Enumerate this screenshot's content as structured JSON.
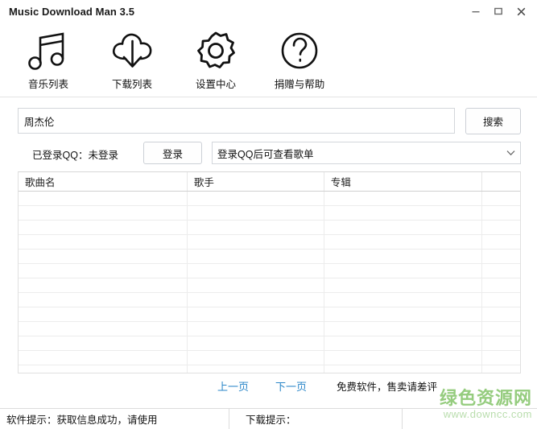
{
  "window": {
    "title": "Music Download Man 3.5",
    "controls": [
      {
        "name": "minimize",
        "label": "–"
      },
      {
        "name": "maximize",
        "label": "□"
      },
      {
        "name": "close",
        "label": "✕"
      }
    ]
  },
  "toolbar": {
    "items": [
      {
        "icon": "music-note-icon",
        "label": "音乐列表"
      },
      {
        "icon": "cloud-download-icon",
        "label": "下载列表"
      },
      {
        "icon": "gear-icon",
        "label": "设置中心"
      },
      {
        "icon": "question-circle-icon",
        "label": "捐赠与帮助"
      }
    ]
  },
  "search": {
    "value": "周杰伦",
    "placeholder": "",
    "button_label": "搜索"
  },
  "login": {
    "status_text": "已登录QQ：未登录",
    "button_label": "登录",
    "playlist_selected": "登录QQ后可查看歌单",
    "playlist_chevron": "chevron-down-icon"
  },
  "table": {
    "columns": [
      {
        "key": "song",
        "label": "歌曲名",
        "width": "33.6%"
      },
      {
        "key": "artist",
        "label": "歌手",
        "width": "27.3%"
      },
      {
        "key": "album",
        "label": "专辑",
        "width": "31.5%"
      },
      {
        "key": "extra",
        "label": "",
        "width": "7.6%"
      }
    ],
    "rows": [
      {
        "song": "",
        "artist": "",
        "album": "",
        "extra": ""
      },
      {
        "song": "",
        "artist": "",
        "album": "",
        "extra": ""
      },
      {
        "song": "",
        "artist": "",
        "album": "",
        "extra": ""
      },
      {
        "song": "",
        "artist": "",
        "album": "",
        "extra": ""
      },
      {
        "song": "",
        "artist": "",
        "album": "",
        "extra": ""
      },
      {
        "song": "",
        "artist": "",
        "album": "",
        "extra": ""
      },
      {
        "song": "",
        "artist": "",
        "album": "",
        "extra": ""
      },
      {
        "song": "",
        "artist": "",
        "album": "",
        "extra": ""
      },
      {
        "song": "",
        "artist": "",
        "album": "",
        "extra": ""
      },
      {
        "song": "",
        "artist": "",
        "album": "",
        "extra": ""
      },
      {
        "song": "",
        "artist": "",
        "album": "",
        "extra": ""
      },
      {
        "song": "",
        "artist": "",
        "album": "",
        "extra": ""
      },
      {
        "song": "",
        "artist": "",
        "album": "",
        "extra": ""
      },
      {
        "song": "",
        "artist": "",
        "album": "",
        "extra": ""
      }
    ]
  },
  "pager": {
    "prev_label": "上一页",
    "next_label": "下一页",
    "notice": "免费软件，售卖请差评"
  },
  "watermark": {
    "text": "绿色资源网",
    "url": "www.downcc.com",
    "color": "#95cc7e"
  },
  "statusbar": {
    "software_hint": "软件提示：获取信息成功，请使用",
    "download_hint": "下载提示：",
    "rest": ""
  },
  "colors": {
    "link": "#2a86c8",
    "border": "#d3d6db",
    "grid_line": "#ececec",
    "watermark_green": "#95cc7e"
  }
}
